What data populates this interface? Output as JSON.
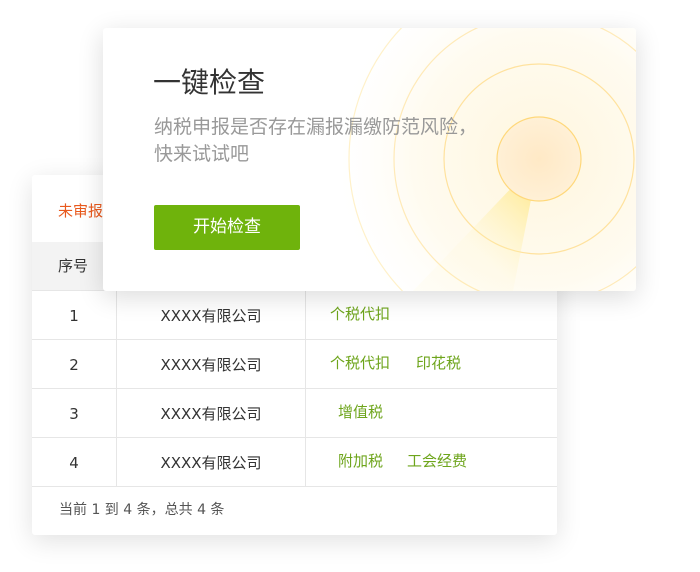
{
  "promo": {
    "title": "一键检查",
    "subtitle_line1": "纳税申报是否存在漏报漏缴防范风险，",
    "subtitle_line2": "快来试试吧",
    "start_button": "开始检查",
    "accent_color": "#6fb30c"
  },
  "table_card": {
    "tab_label": "未审报",
    "columns": [
      "序号"
    ],
    "rows": [
      {
        "index": "1",
        "company": "XXXX有限公司",
        "tags": [
          "个税代扣"
        ]
      },
      {
        "index": "2",
        "company": "XXXX有限公司",
        "tags": [
          "个税代扣",
          "印花税"
        ]
      },
      {
        "index": "3",
        "company": "XXXX有限公司",
        "tags": [
          "增值税"
        ]
      },
      {
        "index": "4",
        "company": "XXXX有限公司",
        "tags": [
          "附加税",
          "工会经费"
        ]
      }
    ],
    "footer": "当前 1 到 4 条，总共 4 条"
  },
  "colors": {
    "tab": "#e8591d",
    "tag": "#6ea51c",
    "radar": "#ffd84d"
  },
  "icons": {
    "radar": "radar-scan-graphic"
  }
}
